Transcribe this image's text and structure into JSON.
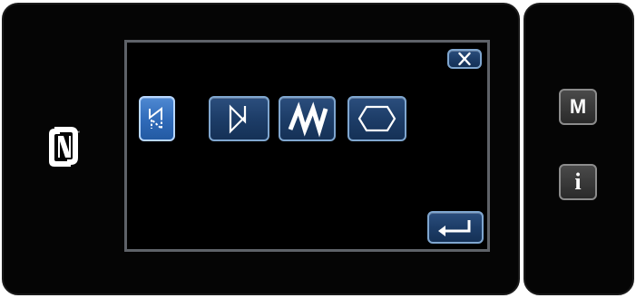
{
  "colors": {
    "panel_background": "#050505",
    "screen_border": "#5e6268",
    "button_blue": "#1d3d68",
    "button_selected": "#2f6ab8",
    "button_gray": "#3a3a3a"
  },
  "nfc": {
    "icon": "nfc-n-mark-icon"
  },
  "dialog": {
    "close_icon": "close-x-icon",
    "patterns": [
      {
        "icon": "pattern-zigzag-dashed-icon",
        "selected": true
      },
      {
        "icon": "pattern-bowtie-icon",
        "selected": false
      },
      {
        "icon": "pattern-w-zigzag-icon",
        "selected": false
      },
      {
        "icon": "pattern-hexagon-icon",
        "selected": false
      }
    ],
    "enter_icon": "enter-return-arrow-icon"
  },
  "side_buttons": {
    "mode_label": "M",
    "info_label": "i"
  }
}
